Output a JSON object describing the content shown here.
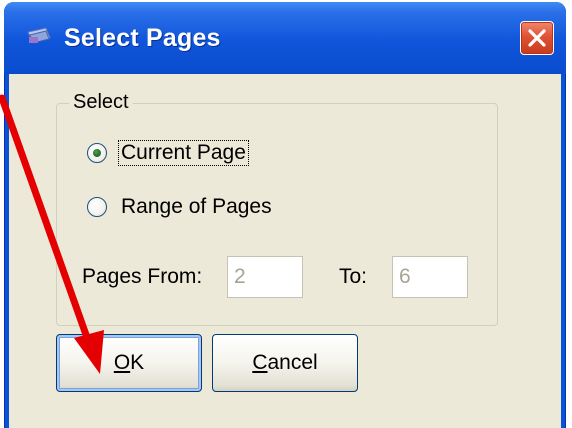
{
  "dialog": {
    "title": "Select Pages",
    "close_glyph": "✕"
  },
  "group": {
    "label": "Select",
    "options": [
      {
        "label": "Current Page",
        "selected": true
      },
      {
        "label": "Range of Pages",
        "selected": false
      }
    ]
  },
  "range": {
    "from_label": "Pages From:",
    "from_value": "2",
    "to_label": "To:",
    "to_value": "6",
    "disabled": true
  },
  "buttons": {
    "ok": {
      "mnemonic": "O",
      "rest": "K"
    },
    "cancel": {
      "mnemonic": "C",
      "rest": "ancel"
    }
  },
  "colors": {
    "titlebar": "#0a52d8",
    "dialog_face": "#ece9d8",
    "close_button": "#e05233",
    "radio_dot": "#2f7a2f",
    "annotation_arrow": "#e40000"
  },
  "icons": {
    "title_icon": "app-icon",
    "close_icon": "close-icon",
    "annotation": "red-arrow-icon"
  }
}
